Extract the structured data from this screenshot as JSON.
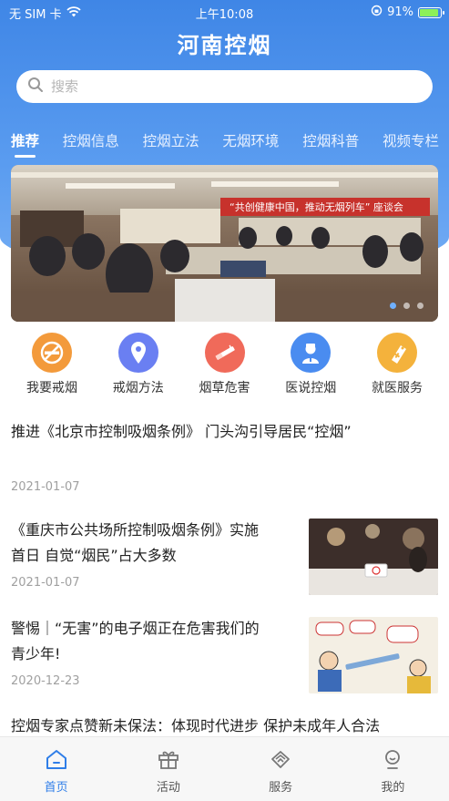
{
  "status_bar": {
    "carrier": "无 SIM 卡",
    "time": "上午10:08",
    "battery_percent": "91%",
    "battery_level": 0.91
  },
  "header": {
    "title": "河南控烟"
  },
  "search": {
    "placeholder": "搜索"
  },
  "tabs": [
    {
      "label": "推荐",
      "active": true
    },
    {
      "label": "控烟信息",
      "active": false
    },
    {
      "label": "控烟立法",
      "active": false
    },
    {
      "label": "无烟环境",
      "active": false
    },
    {
      "label": "控烟科普",
      "active": false
    },
    {
      "label": "视频专栏",
      "active": false
    }
  ],
  "banner": {
    "slide_count": 3,
    "active_slide": 1
  },
  "quick_links": [
    {
      "label": "我要戒烟",
      "icon": "no-smoking-icon",
      "color": "#f39a3b"
    },
    {
      "label": "戒烟方法",
      "icon": "location-pin-icon",
      "color": "#6a7ff2"
    },
    {
      "label": "烟草危害",
      "icon": "cigarette-icon",
      "color": "#f06a5a"
    },
    {
      "label": "医说控烟",
      "icon": "doctor-icon",
      "color": "#4a8cf0"
    },
    {
      "label": "就医服务",
      "icon": "medicine-tag-icon",
      "color": "#f4b23c"
    }
  ],
  "news": [
    {
      "title_lines": [
        "推进《北京市控制吸烟条例》 门头沟引导居民“控烟”"
      ],
      "date": "2021-01-07",
      "has_thumb": false
    },
    {
      "title_lines": [
        "《重庆市公共场所控制吸烟条例》实施",
        "首日 自觉“烟民”占大多数"
      ],
      "date": "2021-01-07",
      "has_thumb": true
    },
    {
      "title_lines": [
        "警惕｜“无害”的电子烟正在危害我们的",
        "青少年!"
      ],
      "date": "2020-12-23",
      "has_thumb": true
    },
    {
      "title_lines": [
        "控烟专家点赞新未保法：体现时代进步 保护未成年人合法"
      ],
      "date": "",
      "has_thumb": false
    }
  ],
  "tab_bar": [
    {
      "label": "首页",
      "icon": "home-icon",
      "active": true
    },
    {
      "label": "活动",
      "icon": "gift-icon",
      "active": false
    },
    {
      "label": "服务",
      "icon": "handshake-icon",
      "active": false
    },
    {
      "label": "我的",
      "icon": "user-icon",
      "active": false
    }
  ],
  "colors": {
    "brand": "#3f86e6",
    "tab_active": "#2f7ee8"
  }
}
